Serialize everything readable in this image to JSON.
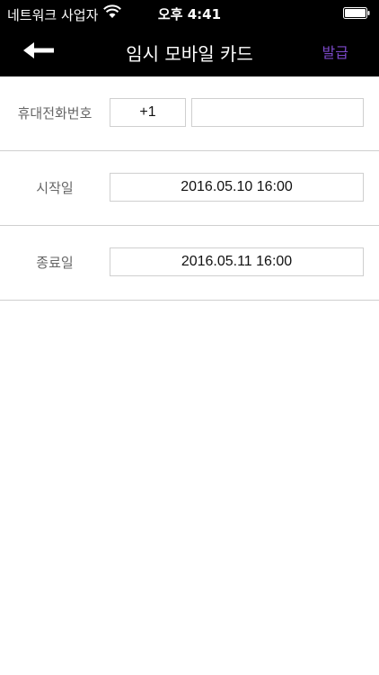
{
  "status_bar": {
    "carrier": "네트워크 사업자",
    "time": "오후 4:41"
  },
  "nav": {
    "title": "임시 모바일 카드",
    "issue_label": "발급"
  },
  "form": {
    "phone": {
      "label": "휴대전화번호",
      "country_code": "+1",
      "number_value": ""
    },
    "start_date": {
      "label": "시작일",
      "value": "2016.05.10 16:00"
    },
    "end_date": {
      "label": "종료일",
      "value": "2016.05.11 16:00"
    }
  },
  "colors": {
    "bar_background": "#000000",
    "accent": "#7b48c8",
    "divider": "#cfcfcf",
    "label_text": "#666666"
  },
  "icons": [
    "wifi-icon",
    "battery-icon",
    "back-arrow-icon"
  ]
}
